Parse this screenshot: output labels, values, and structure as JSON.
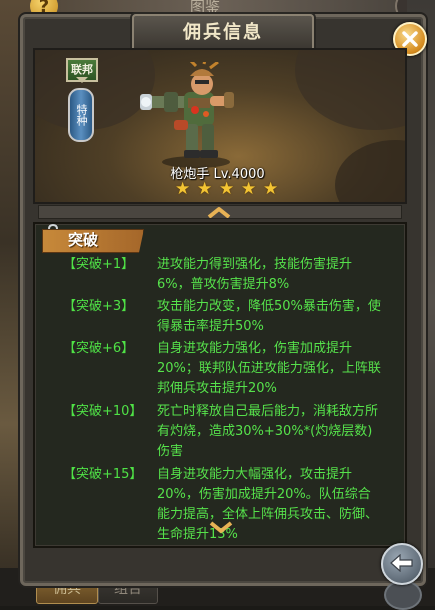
{
  "background": {
    "top_title": "图鉴",
    "tabs": [
      "佣兵",
      "组合"
    ]
  },
  "window": {
    "title": "佣兵信息"
  },
  "hero": {
    "faction": "联邦",
    "type": "特种",
    "name_level": "枪炮手 Lv.4000",
    "stars": 5
  },
  "breakthrough": {
    "title": "突破",
    "rows": [
      {
        "label": "【突破+1】",
        "text": "进攻能力得到强化，技能伤害提升6%，普攻伤害提升8%"
      },
      {
        "label": "【突破+3】",
        "text": "攻击能力改变，降低50%暴击伤害，使得暴击率提升50%"
      },
      {
        "label": "【突破+6】",
        "text": "自身进攻能力强化，伤害加成提升20%；联邦队伍进攻能力强化，上阵联邦佣兵攻击提升20%"
      },
      {
        "label": "【突破+10】",
        "text": "死亡时释放自己最后能力，消耗敌方所有灼烧，造成30%+30%*(灼烧层数)伤害"
      },
      {
        "label": "【突破+15】",
        "text": "自身进攻能力大幅强化，攻击提升20%，伤害加成提升20%。队伍综合能力提高，全体上阵佣兵攻击、防御、生命提升13%"
      }
    ]
  },
  "colors": {
    "effect_text": "#56e24b",
    "panel": "#37342f",
    "tag": "#c7893a"
  }
}
